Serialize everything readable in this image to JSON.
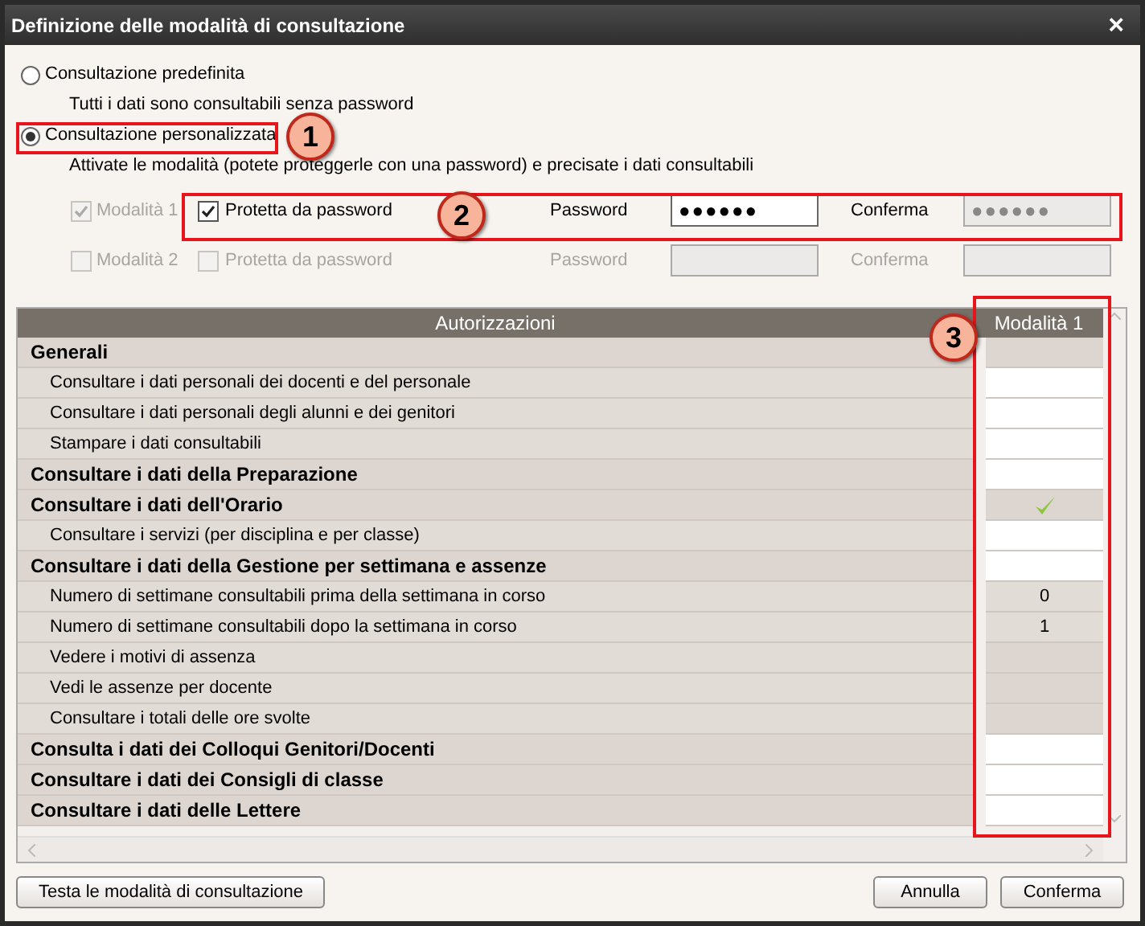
{
  "window": {
    "title": "Definizione delle modalità di consultazione",
    "close": "×"
  },
  "options": [
    {
      "label": "Consultazione predefinita",
      "selected": false,
      "description": "Tutti i dati sono consultabili senza password"
    },
    {
      "label": "Consultazione personalizzata",
      "selected": true,
      "description": "Attivate le modalità (potete proteggerle con una password) e precisate i dati consultabili"
    }
  ],
  "modes": [
    {
      "label": "Modalità 1",
      "checked": true,
      "disabled": true,
      "active": true,
      "protect_label": "Protetta da password",
      "protected": true,
      "password_label": "Password",
      "password": "●●●●●●",
      "confirm_label": "Conferma",
      "confirm": "●●●●●●"
    },
    {
      "label": "Modalità 2",
      "checked": false,
      "disabled": true,
      "active": false,
      "protect_label": "Protetta da password",
      "protected": false,
      "password_label": "Password",
      "confirm_label": "Conferma"
    }
  ],
  "table": {
    "columns": [
      "Autorizzazioni",
      "Modalità 1"
    ],
    "rows": [
      {
        "kind": "group",
        "label": "Generali",
        "cell": {
          "kind": "none"
        }
      },
      {
        "kind": "item",
        "label": "Consultare i dati personali dei docenti e del personale",
        "cell": {
          "kind": "blank"
        }
      },
      {
        "kind": "item",
        "label": "Consultare i dati personali degli alunni e dei genitori",
        "cell": {
          "kind": "blank"
        }
      },
      {
        "kind": "item",
        "label": "Stampare i dati consultabili",
        "cell": {
          "kind": "blank"
        }
      },
      {
        "kind": "group",
        "label": "Consultare i dati della Preparazione",
        "cell": {
          "kind": "blank"
        }
      },
      {
        "kind": "group",
        "label": "Consultare i dati dell'Orario",
        "cell": {
          "kind": "check"
        }
      },
      {
        "kind": "item",
        "label": "Consultare i servizi (per disciplina e per classe)",
        "cell": {
          "kind": "blank"
        }
      },
      {
        "kind": "group",
        "label": "Consultare i dati della Gestione per settimana e assenze",
        "cell": {
          "kind": "blank"
        }
      },
      {
        "kind": "item",
        "label": "Numero di settimane consultabili prima della settimana in corso",
        "cell": {
          "kind": "value",
          "value": "0"
        }
      },
      {
        "kind": "item",
        "label": "Numero di settimane consultabili dopo la settimana in corso",
        "cell": {
          "kind": "value",
          "value": "1"
        }
      },
      {
        "kind": "item",
        "label": "Vedere i motivi di assenza",
        "cell": {
          "kind": "none"
        }
      },
      {
        "kind": "item",
        "label": "Vedi le assenze per docente",
        "cell": {
          "kind": "none"
        }
      },
      {
        "kind": "item",
        "label": "Consultare i totali delle ore svolte",
        "cell": {
          "kind": "none"
        }
      },
      {
        "kind": "group",
        "label": "Consulta i dati dei Colloqui Genitori/Docenti",
        "cell": {
          "kind": "blank"
        }
      },
      {
        "kind": "group",
        "label": "Consultare i dati dei Consigli di classe",
        "cell": {
          "kind": "blank"
        }
      },
      {
        "kind": "group",
        "label": "Consultare i dati delle Lettere",
        "cell": {
          "kind": "blank"
        }
      }
    ]
  },
  "buttons": {
    "left": "Testa le modalità di consultazione",
    "cancel": "Annulla",
    "confirm": "Conferma"
  },
  "callouts": [
    "1",
    "2",
    "3"
  ]
}
